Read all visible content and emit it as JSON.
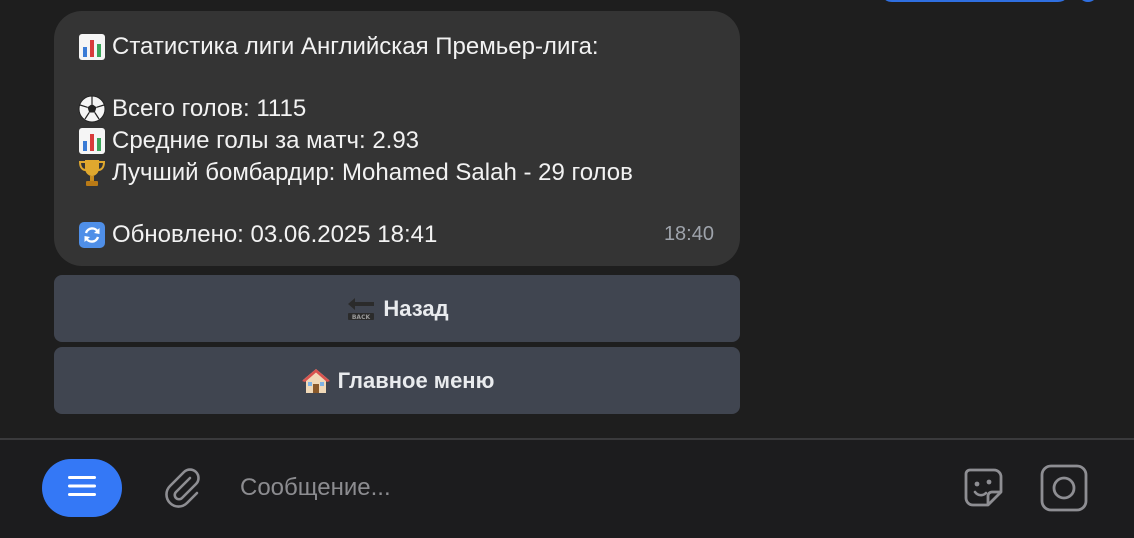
{
  "message": {
    "title_icon": "bar-chart-icon",
    "title": "Статистика лиги Английская Премьер-лига:",
    "total_goals_icon": "soccer-ball-icon",
    "total_goals": "Всего голов: 1115",
    "avg_goals_icon": "bar-chart-icon",
    "avg_goals": "Средние голы за матч: 2.93",
    "top_scorer_icon": "trophy-icon",
    "top_scorer": "Лучший бомбардир: Mohamed Salah - 29 голов",
    "updated_icon": "refresh-icon",
    "updated": "Обновлено: 03.06.2025 18:41",
    "time": "18:40"
  },
  "keyboard": {
    "back_icon": "back-arrow-icon",
    "back_label": "Назад",
    "menu_icon": "house-icon",
    "menu_label": "Главное меню"
  },
  "input_bar": {
    "menu_icon": "menu-icon",
    "attach_icon": "paperclip-icon",
    "placeholder": "Сообщение...",
    "sticker_icon": "sticker-icon",
    "camera_icon": "camera-icon"
  },
  "colors": {
    "accent": "#3478f6",
    "bubble": "#343434",
    "button": "#404550",
    "background": "#1e1e1e"
  }
}
